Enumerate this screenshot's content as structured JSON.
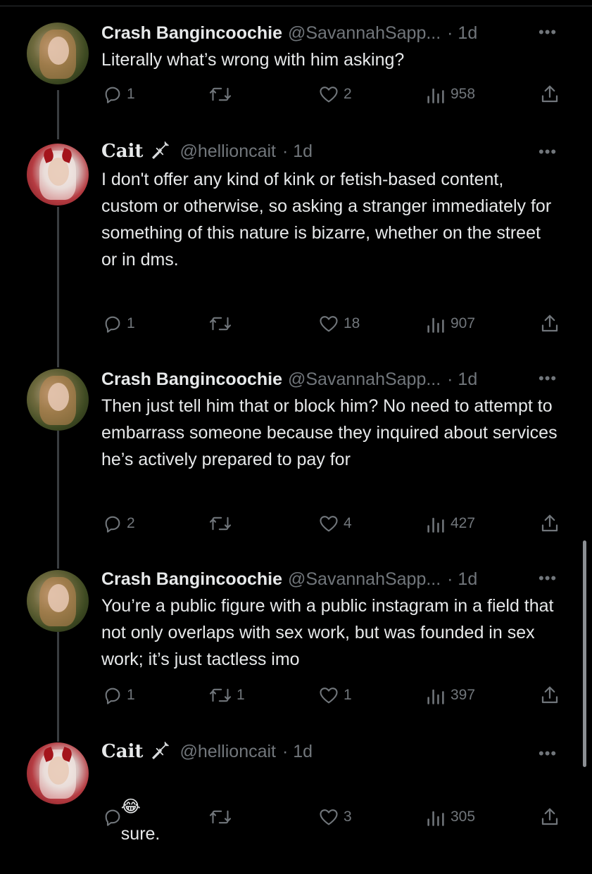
{
  "tweets": [
    {
      "author_type": "crash",
      "name": "Crash Bangincoochie",
      "handle": "@SavannahSapp...",
      "time": "· 1d",
      "text": "Literally what’s wrong with him asking?",
      "replies": "1",
      "retweets": "",
      "likes": "2",
      "views": "958"
    },
    {
      "author_type": "cait",
      "name": "Cait",
      "handle": "@hellioncait",
      "time": "· 1d",
      "text": "I don't offer any kind of kink or fetish-based content, custom or otherwise, so asking a stranger immediately for something of this nature is bizarre, whether on the street or in dms.",
      "replies": "1",
      "retweets": "",
      "likes": "18",
      "views": "907"
    },
    {
      "author_type": "crash",
      "name": "Crash Bangincoochie",
      "handle": "@SavannahSapp...",
      "time": "· 1d",
      "text": "Then just tell him that or block him? No need to attempt to embarrass someone because they inquired about services he’s actively prepared to pay for",
      "replies": "2",
      "retweets": "",
      "likes": "4",
      "views": "427"
    },
    {
      "author_type": "crash",
      "name": "Crash Bangincoochie",
      "handle": "@SavannahSapp...",
      "time": "· 1d",
      "text": "You’re a public figure with a public instagram in a field that not only overlaps with sex work, but was founded in sex work; it’s just tactless imo",
      "replies": "1",
      "retweets": "1",
      "likes": "1",
      "views": "397"
    },
    {
      "author_type": "cait",
      "name": "Cait",
      "handle": "@hellioncait",
      "time": "· 1d",
      "emoji": "😂",
      "text": "sure.",
      "replies": "",
      "retweets": "",
      "likes": "3",
      "views": "305"
    }
  ],
  "more_label": "•••",
  "icons": [
    "reply-icon",
    "retweet-icon",
    "like-icon",
    "views-icon",
    "share-icon",
    "dagger-icon"
  ],
  "colors": {
    "background": "#000000",
    "text": "#e7e9ea",
    "muted": "#71767b"
  }
}
